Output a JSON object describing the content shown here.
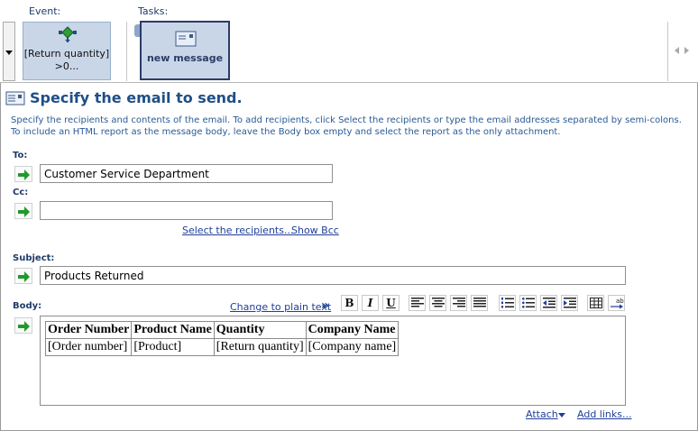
{
  "strip": {
    "event_label": "Event:",
    "tasks_label": "Tasks:",
    "event_card_text": "[Return quantity] >0...",
    "task_card_text": "new message"
  },
  "header": {
    "title": "Specify the email to send.",
    "instructions": "Specify the recipients and contents of the email. To add recipients, click Select the recipients or type the email addresses separated by semi-colons. To include an HTML report as the message body, leave the Body box empty and select the report as the only attachment."
  },
  "fields": {
    "to_label": "To:",
    "to_value": "Customer Service Department",
    "cc_label": "Cc:",
    "cc_value": "",
    "select_recipients_link": "Select the recipients...",
    "show_bcc_link": "Show Bcc",
    "subject_label": "Subject:",
    "subject_value": "Products Returned",
    "body_label": "Body:"
  },
  "editor": {
    "change_to_plain_text": "Change to plain text",
    "double_chevron": "»",
    "bold": "B",
    "italic": "I",
    "underline": "U"
  },
  "body_table": {
    "headers": [
      "Order Number",
      "Product Name",
      "Quantity",
      "Company Name"
    ],
    "row": [
      "[Order number]",
      "[Product]",
      "[Return quantity]",
      "[Company name]"
    ]
  },
  "footer": {
    "attach_link": "Attach",
    "add_links_link": "Add links..."
  },
  "colors": {
    "accent_blue": "#1f4f86",
    "card_bg": "#c9d6e8",
    "arrow_green": "#1e9a2a"
  }
}
